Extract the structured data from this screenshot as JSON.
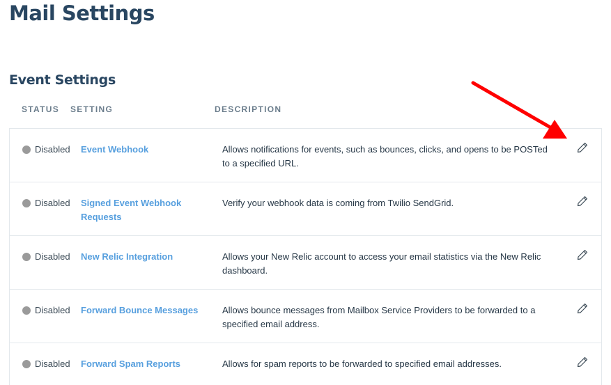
{
  "page": {
    "title": "Mail Settings"
  },
  "section": {
    "title": "Event Settings"
  },
  "columns": {
    "status": "STATUS",
    "setting": "SETTING",
    "description": "DESCRIPTION"
  },
  "rows": [
    {
      "status": "Disabled",
      "setting": "Event Webhook",
      "description": "Allows notifications for events, such as bounces, clicks, and opens to be POSTed to a specified URL."
    },
    {
      "status": "Disabled",
      "setting": "Signed Event Webhook Requests",
      "description": "Verify your webhook data is coming from Twilio SendGrid."
    },
    {
      "status": "Disabled",
      "setting": "New Relic Integration",
      "description": "Allows your New Relic account to access your email statistics via the New Relic dashboard."
    },
    {
      "status": "Disabled",
      "setting": "Forward Bounce Messages",
      "description": "Allows bounce messages from Mailbox Service Providers to be forwarded to a specified email address."
    },
    {
      "status": "Disabled",
      "setting": "Forward Spam Reports",
      "description": "Allows for spam reports to be forwarded to specified email addresses."
    }
  ],
  "icons": {
    "edit": "pencil-icon",
    "status": "status-dot",
    "annotation": "red-arrow"
  },
  "colors": {
    "heading": "#294661",
    "link": "#3a8fd9",
    "disabled_dot": "#9a9a9a",
    "border": "#e3e8ec",
    "arrow": "#ff0000"
  }
}
